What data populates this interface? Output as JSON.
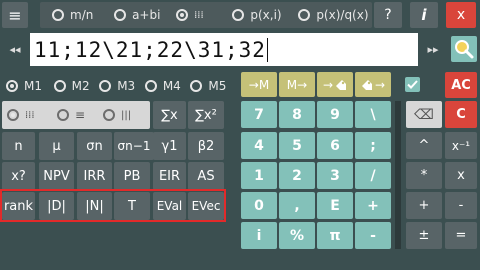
{
  "top_bar": {
    "menu_icon": "≡",
    "tabs": [
      {
        "label": "m/n",
        "selected": false
      },
      {
        "label": "a+bi",
        "selected": false
      },
      {
        "label": "⁞⁞⁞",
        "selected": true
      },
      {
        "label": "p(x,i)",
        "selected": false
      },
      {
        "label": "p(x)/q(x)",
        "selected": false
      }
    ],
    "help_label": "?",
    "info_label": "i",
    "close_label": "x"
  },
  "input": {
    "left_arrows": "◂◂",
    "value": "11;12\\21;22\\31;32",
    "right_arrows": "▸▸"
  },
  "memory": {
    "items": [
      {
        "label": "M1",
        "selected": true
      },
      {
        "label": "M2",
        "selected": false
      },
      {
        "label": "M3",
        "selected": false
      },
      {
        "label": "M4",
        "selected": false
      },
      {
        "label": "M5",
        "selected": false
      }
    ],
    "to_memory": "→M",
    "from_memory": "M→",
    "tag_in": "→",
    "tag_out": "→",
    "ac_label": "AC",
    "checkbox_checked": true
  },
  "modes": {
    "items": [
      {
        "label": "⁞⁞⁞",
        "selected": true
      },
      {
        "label": "≡",
        "selected": false
      },
      {
        "label": "|||",
        "selected": false
      }
    ]
  },
  "stats_keys": {
    "sum_x": "∑x",
    "sum_x2": "∑x²",
    "row1": [
      "n",
      "μ",
      "σn",
      "σn−1",
      "γ1",
      "β2"
    ],
    "row2": [
      "x?",
      "NPV",
      "IRR",
      "PB",
      "EIR",
      "AS"
    ],
    "row3": [
      "rank",
      "|D|",
      "|N|",
      "T",
      "EVal",
      "EVec"
    ]
  },
  "numpad": {
    "rows": [
      [
        "7",
        "8",
        "9",
        "\\"
      ],
      [
        "4",
        "5",
        "6",
        ";"
      ],
      [
        "1",
        "2",
        "3",
        "/"
      ],
      [
        "0",
        ",",
        "E",
        "+"
      ],
      [
        "i",
        "%",
        "π",
        "-"
      ]
    ]
  },
  "right_keys": {
    "backspace": "⌫",
    "c_label": "C",
    "pow": "^",
    "inverse": "x⁻¹",
    "times": "*",
    "x": "x",
    "plus": "+",
    "minus": "-",
    "plusminus": "±",
    "equals": "="
  },
  "colors": {
    "background": "#3b4f50",
    "dark_button": "#586467",
    "teal_button": "#83c1b9",
    "olive_button": "#c5c178",
    "red_button": "#d9453b",
    "highlight": "#e22a2a"
  }
}
